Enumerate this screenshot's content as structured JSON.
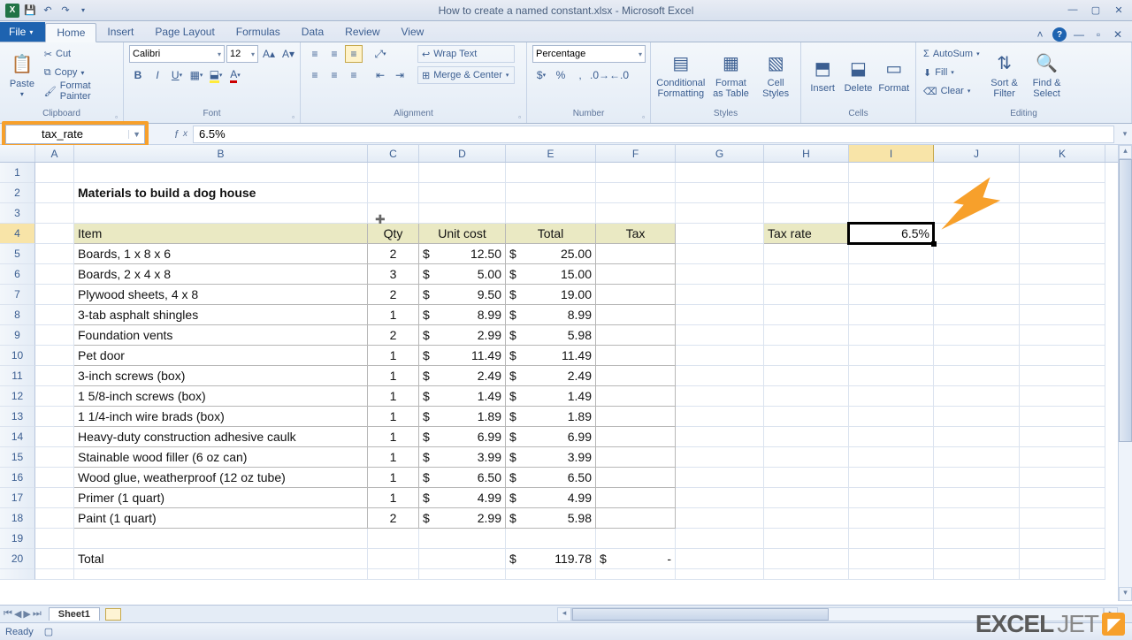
{
  "window": {
    "title": "How to create a named constant.xlsx - Microsoft Excel"
  },
  "tabs": {
    "file": "File",
    "items": [
      "Home",
      "Insert",
      "Page Layout",
      "Formulas",
      "Data",
      "Review",
      "View"
    ],
    "active": "Home"
  },
  "ribbon": {
    "clipboard": {
      "label": "Clipboard",
      "paste": "Paste",
      "cut": "Cut",
      "copy": "Copy",
      "fp": "Format Painter"
    },
    "font": {
      "label": "Font",
      "name": "Calibri",
      "size": "12"
    },
    "alignment": {
      "label": "Alignment",
      "wrap": "Wrap Text",
      "merge": "Merge & Center"
    },
    "number": {
      "label": "Number",
      "format": "Percentage"
    },
    "styles": {
      "label": "Styles",
      "cf": "Conditional\nFormatting",
      "fat": "Format\nas Table",
      "cs": "Cell\nStyles"
    },
    "cells": {
      "label": "Cells",
      "insert": "Insert",
      "delete": "Delete",
      "format": "Format"
    },
    "editing": {
      "label": "Editing",
      "autosum": "AutoSum",
      "fill": "Fill",
      "clear": "Clear",
      "sort": "Sort &\nFilter",
      "find": "Find &\nSelect"
    }
  },
  "namebox": "tax_rate",
  "formula": "6.5%",
  "columns": [
    "A",
    "B",
    "C",
    "D",
    "E",
    "F",
    "G",
    "H",
    "I",
    "J",
    "K"
  ],
  "selected_col": "I",
  "selected_row": "4",
  "sheet": {
    "title": "Materials to build a dog house",
    "headers": {
      "item": "Item",
      "qty": "Qty",
      "unit": "Unit cost",
      "total": "Total",
      "tax": "Tax"
    },
    "rows": [
      {
        "item": "Boards, 1 x 8 x 6",
        "qty": "2",
        "unit": "12.50",
        "total": "25.00"
      },
      {
        "item": "Boards, 2 x 4 x 8",
        "qty": "3",
        "unit": "5.00",
        "total": "15.00"
      },
      {
        "item": "Plywood sheets, 4 x 8",
        "qty": "2",
        "unit": "9.50",
        "total": "19.00"
      },
      {
        "item": "3-tab asphalt shingles",
        "qty": "1",
        "unit": "8.99",
        "total": "8.99"
      },
      {
        "item": "Foundation vents",
        "qty": "2",
        "unit": "2.99",
        "total": "5.98"
      },
      {
        "item": "Pet door",
        "qty": "1",
        "unit": "11.49",
        "total": "11.49"
      },
      {
        "item": "3-inch screws (box)",
        "qty": "1",
        "unit": "2.49",
        "total": "2.49"
      },
      {
        "item": "1 5/8-inch screws (box)",
        "qty": "1",
        "unit": "1.49",
        "total": "1.49"
      },
      {
        "item": "1 1/4-inch wire brads (box)",
        "qty": "1",
        "unit": "1.89",
        "total": "1.89"
      },
      {
        "item": "Heavy-duty construction adhesive caulk",
        "qty": "1",
        "unit": "6.99",
        "total": "6.99"
      },
      {
        "item": "Stainable wood filler (6 oz can)",
        "qty": "1",
        "unit": "3.99",
        "total": "3.99"
      },
      {
        "item": "Wood glue, weatherproof (12 oz tube)",
        "qty": "1",
        "unit": "6.50",
        "total": "6.50"
      },
      {
        "item": "Primer (1 quart)",
        "qty": "1",
        "unit": "4.99",
        "total": "4.99"
      },
      {
        "item": "Paint (1 quart)",
        "qty": "2",
        "unit": "2.99",
        "total": "5.98"
      }
    ],
    "total_label": "Total",
    "total_value": "119.78",
    "tax_dash": "-",
    "tax_rate_label": "Tax rate",
    "tax_rate_value": "6.5%"
  },
  "sheettab": "Sheet1",
  "status": "Ready",
  "currency": "$",
  "logo": {
    "a": "EXCEL",
    "b": "JET"
  }
}
